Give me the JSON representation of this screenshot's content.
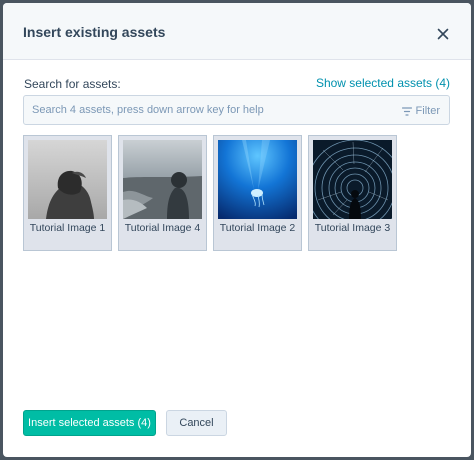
{
  "modal": {
    "title": "Insert existing assets",
    "close_icon": "close-icon"
  },
  "search": {
    "label": "Search for assets:",
    "show_selected": "Show selected assets (4)",
    "placeholder": "Search 4 assets, press down arrow key for help",
    "filter_label": "Filter",
    "filter_icon": "filter-icon"
  },
  "assets": [
    {
      "name": "Tutorial Image 1"
    },
    {
      "name": "Tutorial Image 4"
    },
    {
      "name": "Tutorial Image 2"
    },
    {
      "name": "Tutorial Image 3"
    }
  ],
  "footer": {
    "insert_label": "Insert selected assets (4)",
    "cancel_label": "Cancel"
  },
  "colors": {
    "primary": "#00bda5",
    "link": "#0091ae",
    "text": "#33475b",
    "header_bg": "#f5f8fa"
  }
}
